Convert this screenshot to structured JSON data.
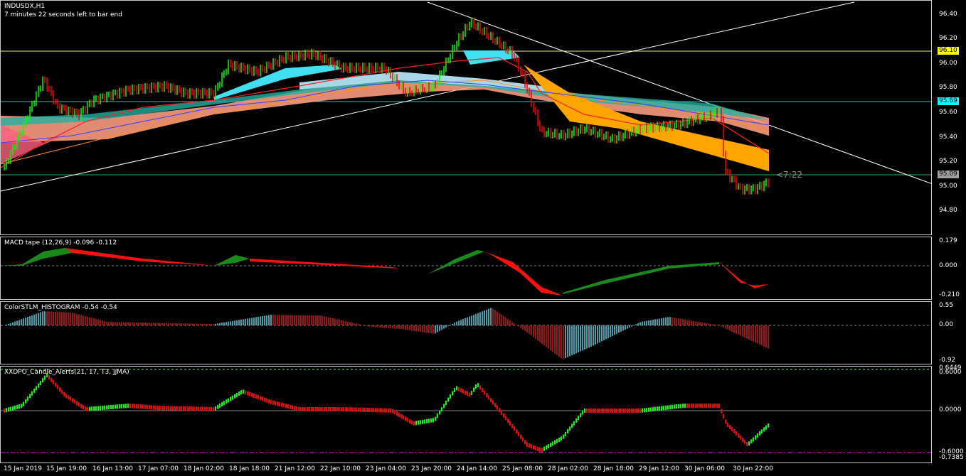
{
  "main": {
    "symbol": "INDUSDX,H1",
    "countdown": "7 minutes 22 seconds left to bar end",
    "timer": "<7:22",
    "yticks": [
      "96.40",
      "96.20",
      "96.00",
      "95.80",
      "95.60",
      "95.40",
      "95.20",
      "95.00",
      "94.80"
    ],
    "tags": {
      "resistance": "96.10",
      "mid": "95.69",
      "price": "95.09"
    },
    "colors": {
      "bull": "#00ff00",
      "bear": "#ff0000",
      "tag_resistance": "#ffff00",
      "tag_mid": "#00ffff",
      "tag_price": "#a0a0a0"
    }
  },
  "macd": {
    "title": "MACD tape (12,26,9) -0.096 -0.112",
    "yticks": [
      "0.179",
      "0.000",
      "-0.210"
    ]
  },
  "stlm": {
    "title": "ColorSTLM_HISTOGRAM -0.54 -0.54",
    "yticks": [
      "0.55",
      "0.00",
      "-0.92"
    ]
  },
  "xdpo": {
    "title": "XXDPO_Candle_Alerts(21, 17, T3, JJMA)",
    "yticks": [
      "0.6449",
      "0.6000",
      "0.0000",
      "-0.6000",
      "-0.7385"
    ]
  },
  "xaxis": [
    "15 Jan 2019",
    "15 Jan 19:00",
    "16 Jan 13:00",
    "17 Jan 07:00",
    "18 Jan 02:00",
    "18 Jan 18:00",
    "21 Jan 12:00",
    "22 Jan 10:00",
    "23 Jan 04:00",
    "23 Jan 20:00",
    "24 Jan 14:00",
    "25 Jan 08:00",
    "28 Jan 02:00",
    "28 Jan 18:00",
    "29 Jan 12:00",
    "30 Jan 06:00",
    "30 Jan 22:00"
  ]
}
